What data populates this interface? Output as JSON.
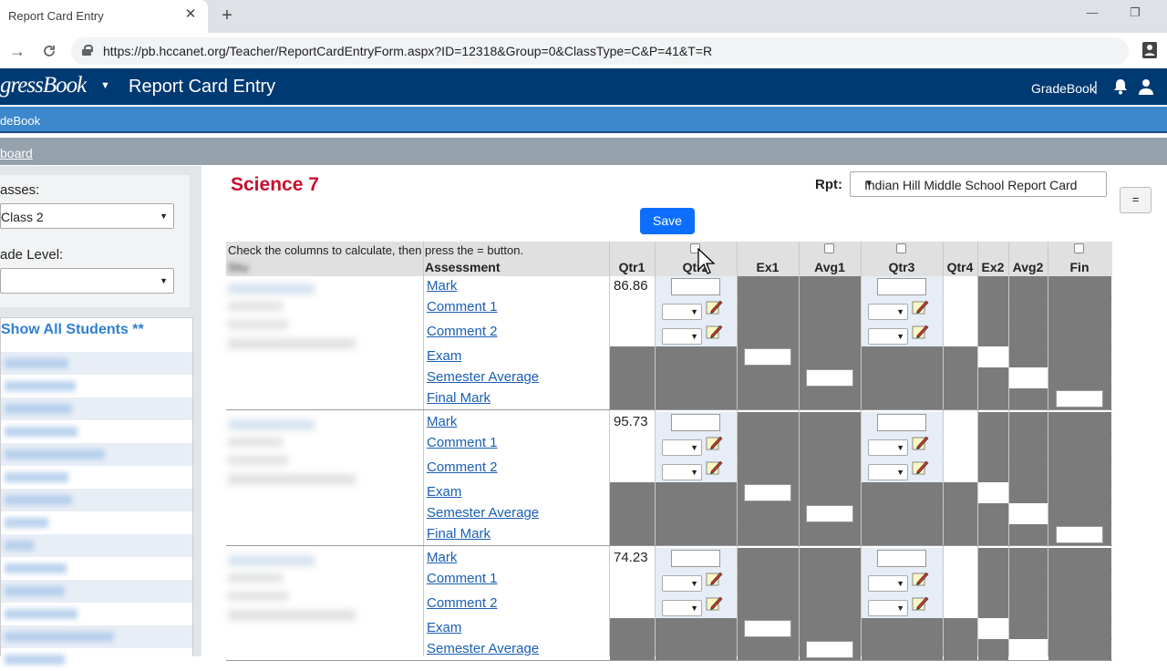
{
  "browser": {
    "tab_title": "Report Card Entry",
    "tab_close": "✕",
    "new_tab": "+",
    "url": "https://pb.hccanet.org/Teacher/ReportCardEntryForm.aspx?ID=12318&Group=0&ClassType=C&P=41&T=R",
    "back_icon": "→",
    "reload_icon": "C",
    "win_min": "—",
    "win_max": "❐"
  },
  "header": {
    "logo": "gressBook",
    "logo_caret": "▼",
    "title": "Report Card Entry",
    "gradebook_link": "GradeBook",
    "separator": "|"
  },
  "subnav": {
    "label": "deBook"
  },
  "crumb": {
    "label": "board"
  },
  "sidebar": {
    "classes_label": "asses:",
    "class_value": "Class 2",
    "grade_label": "ade Level:",
    "grade_value": "",
    "show_all": "Show All Students **"
  },
  "main": {
    "class_title": "Science 7",
    "rpt_label": "Rpt:",
    "rpt_value": "Indian Hill Middle School Report Card",
    "save_label": "Save",
    "eq_label": "=",
    "instructions": "Check the columns to calculate, then press the = button.",
    "assessment_header": "Assessment",
    "name_header": "Stu",
    "columns": [
      "Qtr1",
      "Qtr2",
      "Ex1",
      "Avg1",
      "Qtr3",
      "Qtr4",
      "Ex2",
      "Avg2",
      "Fin"
    ],
    "students": [
      {
        "rows": [
          {
            "label": "Mark",
            "qtr1": "86.86"
          },
          {
            "label": "Comment 1",
            "qtr1": ""
          },
          {
            "label": "Comment 2",
            "qtr1": ""
          },
          {
            "label": "Exam",
            "qtr1": ""
          },
          {
            "label": "Semester Average",
            "qtr1": ""
          },
          {
            "label": "Final Mark",
            "qtr1": ""
          }
        ]
      },
      {
        "rows": [
          {
            "label": "Mark",
            "qtr1": "95.73"
          },
          {
            "label": "Comment 1",
            "qtr1": ""
          },
          {
            "label": "Comment 2",
            "qtr1": ""
          },
          {
            "label": "Exam",
            "qtr1": ""
          },
          {
            "label": "Semester Average",
            "qtr1": ""
          },
          {
            "label": "Final Mark",
            "qtr1": ""
          }
        ]
      },
      {
        "rows": [
          {
            "label": "Mark",
            "qtr1": "74.23"
          },
          {
            "label": "Comment 1",
            "qtr1": ""
          },
          {
            "label": "Comment 2",
            "qtr1": ""
          },
          {
            "label": "Exam",
            "qtr1": ""
          },
          {
            "label": "Semester Average",
            "qtr1": ""
          }
        ]
      }
    ]
  },
  "icons": {
    "lock": "lock-icon",
    "bell": "bell-icon",
    "user": "user-icon",
    "profile": "profile-icon",
    "pen": "edit-comment-icon",
    "cursor": "mouse-cursor"
  },
  "colors": {
    "header_bg": "#003a73",
    "subnav_bg": "#3d87cc",
    "title_red": "#c8102e",
    "link_blue": "#1a5fb4",
    "save_blue": "#0d6efd",
    "disabled_cell": "#7b7b7b"
  }
}
